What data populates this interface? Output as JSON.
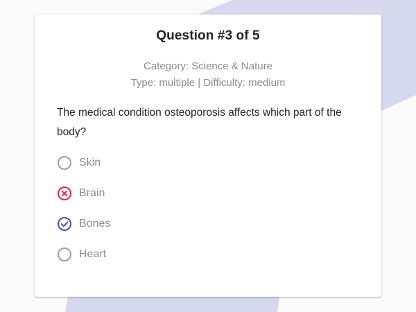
{
  "quiz": {
    "title": "Question #3 of 5",
    "category": "Category: Science & Nature",
    "meta": "Type: multiple | Difficulty: medium",
    "question": "The medical condition osteoporosis affects which part of the body?",
    "options": [
      {
        "label": "Skin",
        "state": "unselected"
      },
      {
        "label": "Brain",
        "state": "wrong"
      },
      {
        "label": "Bones",
        "state": "correct"
      },
      {
        "label": "Heart",
        "state": "unselected"
      }
    ]
  },
  "colors": {
    "page_background": "#fafafa",
    "decor_band": "#d6d8ee",
    "card": "#ffffff",
    "title_text": "#222222",
    "muted_text": "#8a8a8a",
    "unselected_radio": "#9e9e9e",
    "wrong": "#e0245e",
    "correct": "#3f51b5"
  },
  "icons": {
    "unselected": "radio-unchecked-icon",
    "wrong": "radio-cross-icon",
    "correct": "radio-check-icon"
  }
}
